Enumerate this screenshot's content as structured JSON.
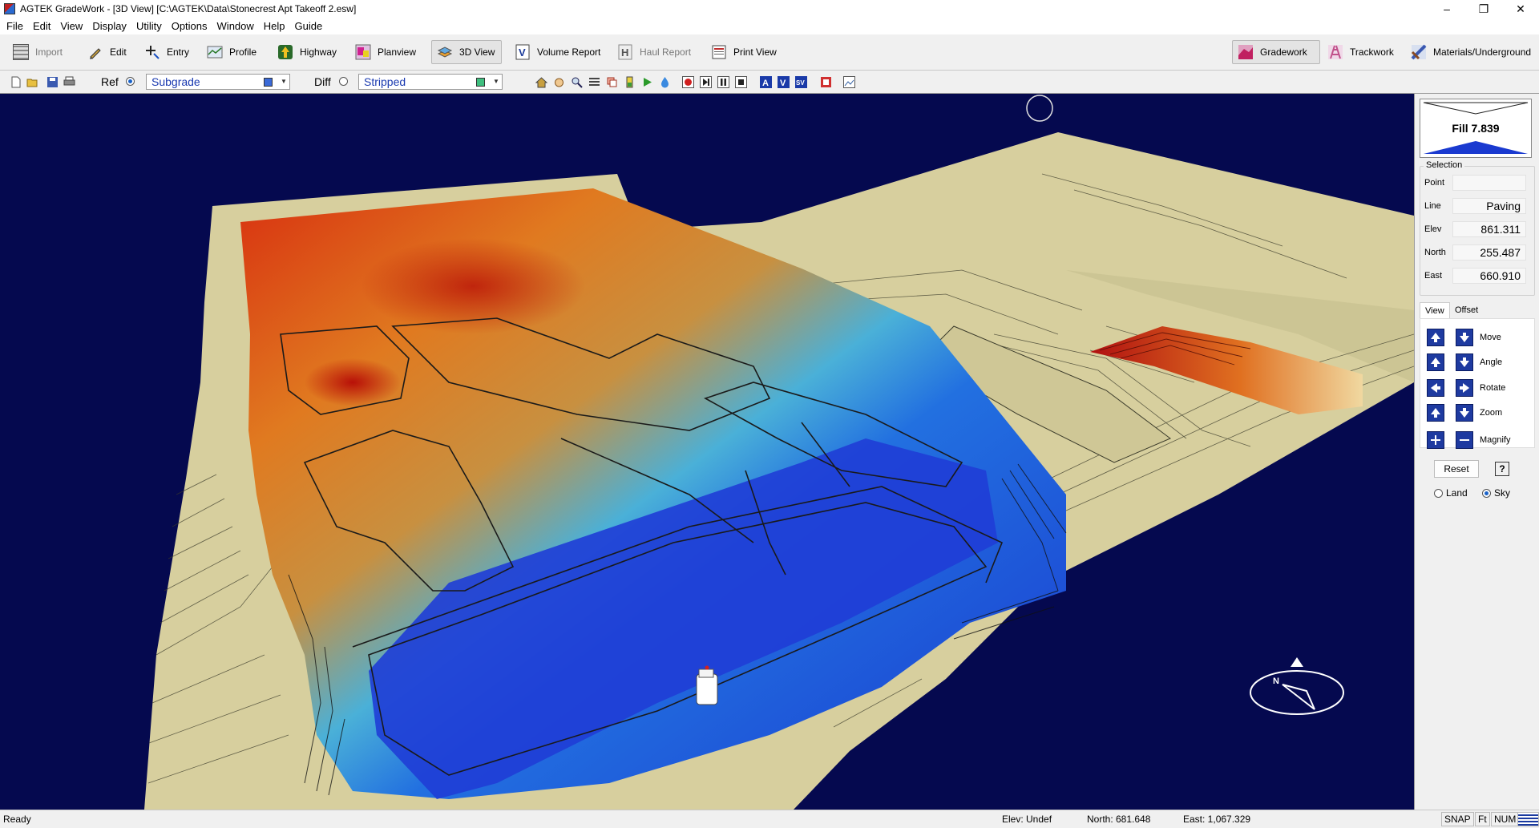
{
  "window": {
    "title": "AGTEK GradeWork - [3D View]  [C:\\AGTEK\\Data\\Stonecrest Apt Takeoff 2.esw]",
    "controls": [
      "–",
      "❐",
      "✕"
    ]
  },
  "menu": [
    "File",
    "Edit",
    "View",
    "Display",
    "Utility",
    "Options",
    "Window",
    "Help",
    "Guide"
  ],
  "toolbar": {
    "main": [
      {
        "label": "Import",
        "icon": "grid-import-icon",
        "enabled": false
      },
      {
        "label": "Edit",
        "icon": "pencil-icon",
        "enabled": true
      },
      {
        "label": "Entry",
        "icon": "crosshair-entry-icon",
        "enabled": true
      },
      {
        "label": "Profile",
        "icon": "profile-icon",
        "enabled": true
      },
      {
        "label": "Highway",
        "icon": "highway-icon",
        "enabled": true
      },
      {
        "label": "Planview",
        "icon": "planview-icon",
        "enabled": true
      },
      {
        "label": "3D View",
        "icon": "3d-view-icon",
        "enabled": true,
        "active": true
      },
      {
        "label": "Volume Report",
        "icon": "volume-report-icon",
        "enabled": true
      },
      {
        "label": "Haul Report",
        "icon": "haul-report-icon",
        "enabled": false
      },
      {
        "label": "Print View",
        "icon": "print-view-icon",
        "enabled": true
      }
    ],
    "modes": [
      {
        "label": "Gradework",
        "icon": "gradework-icon",
        "active": true
      },
      {
        "label": "Trackwork",
        "icon": "trackwork-icon",
        "active": false
      },
      {
        "label": "Materials/Underground",
        "icon": "materials-icon",
        "active": false
      }
    ]
  },
  "surfaces": {
    "ref_label": "Ref",
    "ref_selected": true,
    "ref_value": "Subgrade",
    "ref_color": "#3a6ad8",
    "diff_label": "Diff",
    "diff_selected": false,
    "diff_value": "Stripped",
    "diff_color": "#3fbf7f"
  },
  "side_panel": {
    "fill_label": "Fill 7.839",
    "selection_title": "Selection",
    "fields": [
      {
        "key": "Point",
        "value": ""
      },
      {
        "key": "Line",
        "value": "Paving"
      },
      {
        "key": "Elev",
        "value": "861.311"
      },
      {
        "key": "North",
        "value": "255.487"
      },
      {
        "key": "East",
        "value": "660.910"
      }
    ],
    "tabs": [
      "View",
      "Offset"
    ],
    "controls": [
      "Move",
      "Angle",
      "Rotate",
      "Zoom",
      "Magnify"
    ],
    "reset_label": "Reset",
    "help_label": "?",
    "options": [
      {
        "label": "Land",
        "selected": false
      },
      {
        "label": "Sky",
        "selected": true
      }
    ]
  },
  "status": {
    "ready": "Ready",
    "elev": "Elev: Undef",
    "north": "North: 681.648",
    "east": "East: 1,067.329",
    "snap": "SNAP",
    "units": "Ft",
    "num": "NUM"
  },
  "compass": {
    "north_letter": "N"
  }
}
